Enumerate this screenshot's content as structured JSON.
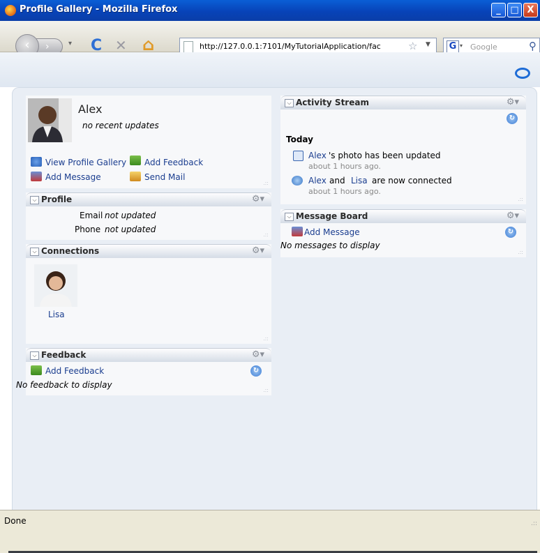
{
  "window": {
    "title": "Profile Gallery - Mozilla Firefox",
    "controls": [
      "_",
      "□",
      "X"
    ]
  },
  "nav": {
    "back": "‹",
    "forward": "›",
    "reload": "C",
    "stop": "✕",
    "home": "⌂",
    "url": "http://127.0.0.1:7101/MyTutorialApplication/fac",
    "search_placeholder": "Google",
    "search_engine": "G"
  },
  "profile": {
    "name": "Alex",
    "status": "no recent updates",
    "actions": {
      "view_gallery": "View Profile Gallery",
      "add_feedback": "Add Feedback",
      "add_message": "Add Message",
      "send_mail": "Send Mail"
    }
  },
  "profile_panel": {
    "title": "Profile",
    "email_label": "Email",
    "email_value": "not updated",
    "phone_label": "Phone",
    "phone_value": "not updated"
  },
  "connections_panel": {
    "title": "Connections",
    "contact": "Lisa"
  },
  "feedback_panel": {
    "title": "Feedback",
    "add": "Add Feedback",
    "empty": "No feedback to display"
  },
  "activity_panel": {
    "title": "Activity Stream",
    "day": "Today",
    "items": [
      {
        "actor": "Alex",
        "text": "'s photo has been updated",
        "time": "about 1 hours ago."
      },
      {
        "actor": "Alex",
        "joiner": "and",
        "actor2": "Lisa",
        "text": "are now connected",
        "time": "about 1 hours ago."
      }
    ]
  },
  "message_panel": {
    "title": "Message Board",
    "add": "Add Message",
    "empty": "No messages to display"
  },
  "statusbar": {
    "text": "Done"
  },
  "colors": {
    "titlebar": "#0843b8",
    "link": "#1a3d8f",
    "panel": "#f7f8fa",
    "frame": "#e9eef5"
  }
}
